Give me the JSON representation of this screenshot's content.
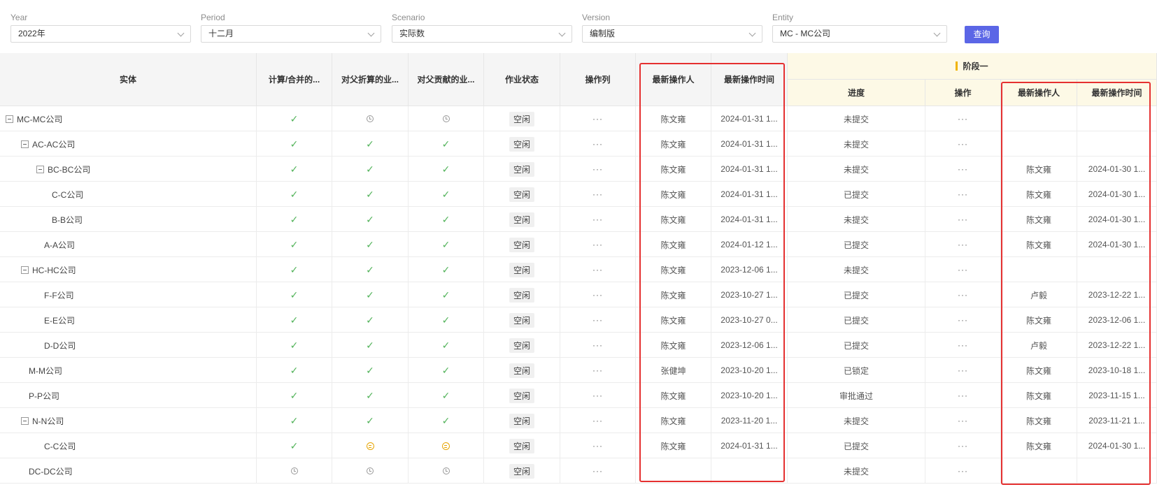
{
  "filters": [
    {
      "label": "Year",
      "value": "2022年"
    },
    {
      "label": "Period",
      "value": "十二月"
    },
    {
      "label": "Scenario",
      "value": "实际数"
    },
    {
      "label": "Version",
      "value": "编制版"
    },
    {
      "label": "Entity",
      "value": "MC - MC公司"
    }
  ],
  "query_button": "查询",
  "columns": {
    "entity": "实体",
    "calc": "计算/合并的...",
    "parent_fold": "对父折算的业...",
    "parent_contrib": "对父贡献的业...",
    "job_status": "作业状态",
    "action_col": "操作列",
    "last_operator": "最新操作人",
    "last_time": "最新操作时间",
    "stage": "阶段一",
    "progress": "进度",
    "operate": "操作",
    "stage_operator": "最新操作人",
    "stage_time": "最新操作时间"
  },
  "rows": [
    {
      "name": "MC-MC公司",
      "level": 0,
      "toggle": true,
      "calc": "check",
      "fold": "pending",
      "contrib": "pending",
      "status": "空闲",
      "dots": "···",
      "op": "陈文雍",
      "time": "2024-01-31 1...",
      "progress": "未提交",
      "opdots": "···",
      "sop": "",
      "stime": ""
    },
    {
      "name": "AC-AC公司",
      "level": 1,
      "toggle": true,
      "calc": "check",
      "fold": "check",
      "contrib": "check",
      "status": "空闲",
      "dots": "···",
      "op": "陈文雍",
      "time": "2024-01-31 1...",
      "progress": "未提交",
      "opdots": "···",
      "sop": "",
      "stime": ""
    },
    {
      "name": "BC-BC公司",
      "level": 2,
      "toggle": true,
      "calc": "check",
      "fold": "check",
      "contrib": "check",
      "status": "空闲",
      "dots": "···",
      "op": "陈文雍",
      "time": "2024-01-31 1...",
      "progress": "未提交",
      "opdots": "···",
      "sop": "陈文雍",
      "stime": "2024-01-30 1..."
    },
    {
      "name": "C-C公司",
      "level": 3,
      "toggle": false,
      "calc": "check",
      "fold": "check",
      "contrib": "check",
      "status": "空闲",
      "dots": "···",
      "op": "陈文雍",
      "time": "2024-01-31 1...",
      "progress": "已提交",
      "opdots": "···",
      "sop": "陈文雍",
      "stime": "2024-01-30 1..."
    },
    {
      "name": "B-B公司",
      "level": 3,
      "toggle": false,
      "calc": "check",
      "fold": "check",
      "contrib": "check",
      "status": "空闲",
      "dots": "···",
      "op": "陈文雍",
      "time": "2024-01-31 1...",
      "progress": "未提交",
      "opdots": "···",
      "sop": "陈文雍",
      "stime": "2024-01-30 1..."
    },
    {
      "name": "A-A公司",
      "level": 2.5,
      "toggle": false,
      "calc": "check",
      "fold": "check",
      "contrib": "check",
      "status": "空闲",
      "dots": "···",
      "op": "陈文雍",
      "time": "2024-01-12 1...",
      "progress": "已提交",
      "opdots": "···",
      "sop": "陈文雍",
      "stime": "2024-01-30 1..."
    },
    {
      "name": "HC-HC公司",
      "level": 1,
      "toggle": true,
      "calc": "check",
      "fold": "check",
      "contrib": "check",
      "status": "空闲",
      "dots": "···",
      "op": "陈文雍",
      "time": "2023-12-06 1...",
      "progress": "未提交",
      "opdots": "···",
      "sop": "",
      "stime": ""
    },
    {
      "name": "F-F公司",
      "level": 2.5,
      "toggle": false,
      "calc": "check",
      "fold": "check",
      "contrib": "check",
      "status": "空闲",
      "dots": "···",
      "op": "陈文雍",
      "time": "2023-10-27 1...",
      "progress": "已提交",
      "opdots": "···",
      "sop": "卢毅",
      "stime": "2023-12-22 1..."
    },
    {
      "name": "E-E公司",
      "level": 2.5,
      "toggle": false,
      "calc": "check",
      "fold": "check",
      "contrib": "check",
      "status": "空闲",
      "dots": "···",
      "op": "陈文雍",
      "time": "2023-10-27 0...",
      "progress": "已提交",
      "opdots": "···",
      "sop": "陈文雍",
      "stime": "2023-12-06 1..."
    },
    {
      "name": "D-D公司",
      "level": 2.5,
      "toggle": false,
      "calc": "check",
      "fold": "check",
      "contrib": "check",
      "status": "空闲",
      "dots": "···",
      "op": "陈文雍",
      "time": "2023-12-06 1...",
      "progress": "已提交",
      "opdots": "···",
      "sop": "卢毅",
      "stime": "2023-12-22 1..."
    },
    {
      "name": "M-M公司",
      "level": 1.5,
      "toggle": false,
      "calc": "check",
      "fold": "check",
      "contrib": "check",
      "status": "空闲",
      "dots": "···",
      "op": "张健坤",
      "time": "2023-10-20 1...",
      "progress": "已锁定",
      "opdots": "···",
      "sop": "陈文雍",
      "stime": "2023-10-18 1..."
    },
    {
      "name": "P-P公司",
      "level": 1.5,
      "toggle": false,
      "calc": "check",
      "fold": "check",
      "contrib": "check",
      "status": "空闲",
      "dots": "···",
      "op": "陈文雍",
      "time": "2023-10-20 1...",
      "progress": "审批通过",
      "opdots": "···",
      "sop": "陈文雍",
      "stime": "2023-11-15 1..."
    },
    {
      "name": "N-N公司",
      "level": 1,
      "toggle": true,
      "calc": "check",
      "fold": "check",
      "contrib": "check",
      "status": "空闲",
      "dots": "···",
      "op": "陈文雍",
      "time": "2023-11-20 1...",
      "progress": "未提交",
      "opdots": "···",
      "sop": "陈文雍",
      "stime": "2023-11-21 1..."
    },
    {
      "name": "C-C公司",
      "level": 2.5,
      "toggle": false,
      "calc": "check",
      "fold": "warn",
      "contrib": "warn",
      "status": "空闲",
      "dots": "···",
      "op": "陈文雍",
      "time": "2024-01-31 1...",
      "progress": "已提交",
      "opdots": "···",
      "sop": "陈文雍",
      "stime": "2024-01-30 1..."
    },
    {
      "name": "DC-DC公司",
      "level": 1.5,
      "toggle": false,
      "calc": "pending",
      "fold": "pending",
      "contrib": "pending",
      "status": "空闲",
      "dots": "···",
      "op": "",
      "time": "",
      "progress": "未提交",
      "opdots": "···",
      "sop": "",
      "stime": ""
    }
  ],
  "colors": {
    "accent": "#5b66e6",
    "check": "#52b35a",
    "warn": "#e7a400",
    "highlight": "#e53030",
    "stage_bg": "#fdf9e6"
  }
}
